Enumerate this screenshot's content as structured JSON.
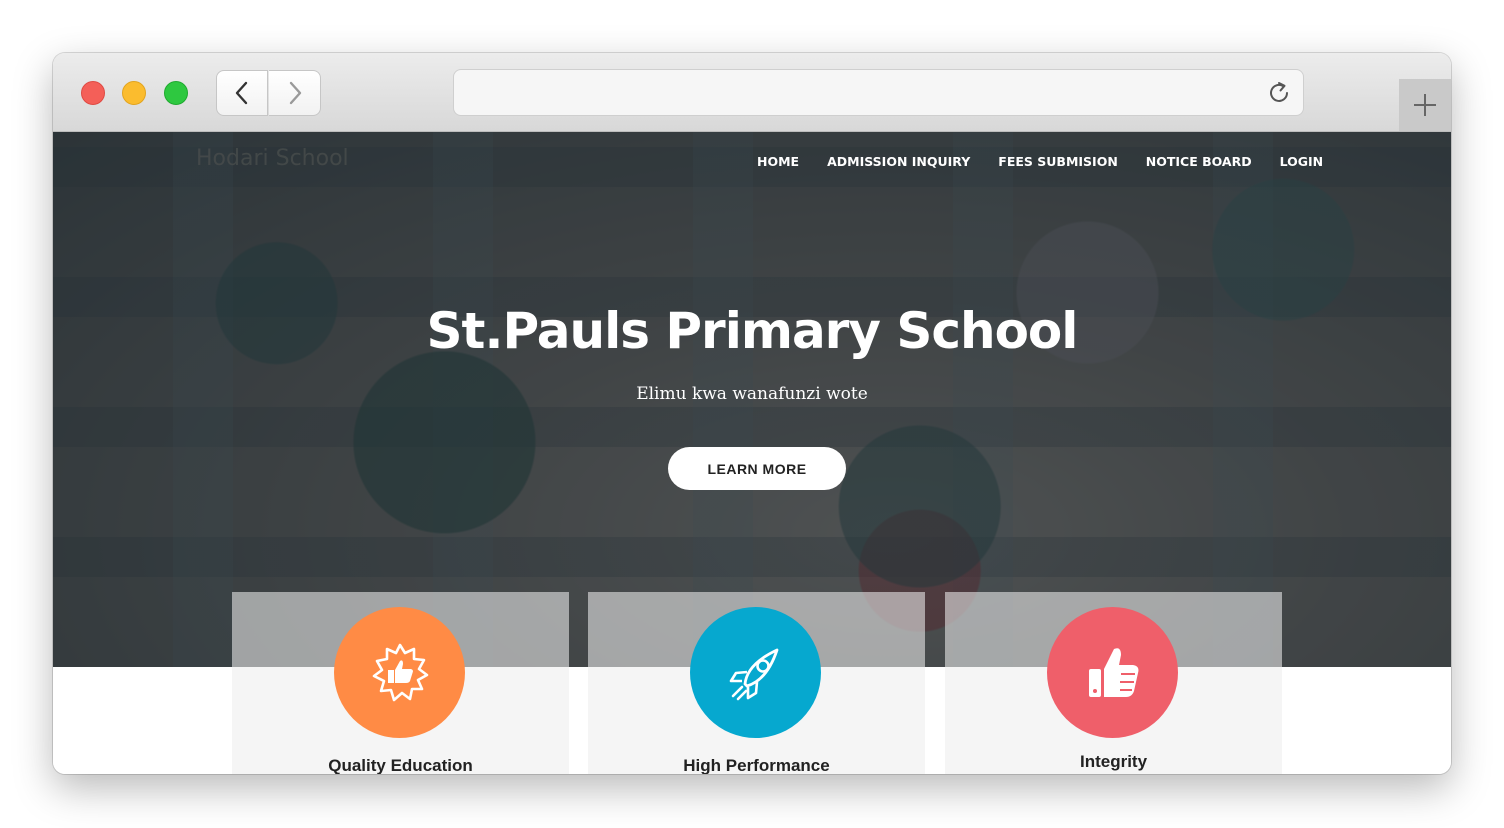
{
  "browser": {
    "url": "",
    "controls": {
      "back_icon": "chevron-left-icon",
      "forward_icon": "chevron-right-icon",
      "reload_icon": "reload-icon",
      "new_tab_icon": "plus-icon"
    },
    "traffic_light_colors": {
      "close": "#f45f58",
      "minimize": "#fbbc2e",
      "zoom": "#2ec840"
    }
  },
  "site": {
    "brand": "Hodari School",
    "nav": [
      {
        "label": "HOME"
      },
      {
        "label": "ADMISSION INQUIRY"
      },
      {
        "label": "FEES SUBMISION"
      },
      {
        "label": "NOTICE BOARD"
      },
      {
        "label": "LOGIN"
      }
    ],
    "hero": {
      "title": "St.Pauls Primary School",
      "subtitle": "Elimu kwa wanafunzi wote",
      "cta_label": "LEARN MORE"
    },
    "features": [
      {
        "title": "Quality Education",
        "icon": "award-thumbs-up-icon",
        "color": "#ff8b45"
      },
      {
        "title": "High Performance",
        "icon": "rocket-icon",
        "color": "#06a8cf"
      },
      {
        "title": "Integrity",
        "icon": "thumbs-up-icon",
        "color": "#ef5f6a"
      }
    ]
  }
}
